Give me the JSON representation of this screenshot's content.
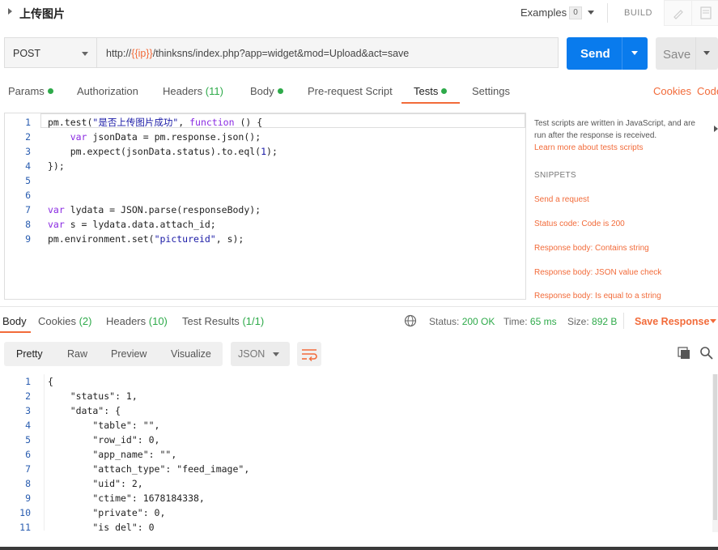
{
  "request": {
    "title": "上传图片",
    "examples_label": "Examples",
    "examples_count": "0",
    "build_label": "BUILD",
    "method": "POST",
    "url_prefix": "http://",
    "url_variable": "{{ip}}",
    "url_suffix": "/thinksns/index.php?app=widget&mod=Upload&act=save",
    "send_label": "Send",
    "save_label": "Save"
  },
  "request_tabs": {
    "params": "Params",
    "authorization": "Authorization",
    "headers": "Headers",
    "headers_count": "(11)",
    "body": "Body",
    "prerequest": "Pre-request Script",
    "tests": "Tests",
    "settings": "Settings",
    "cookies": "Cookies",
    "code": "Code"
  },
  "editor": {
    "line_numbers": [
      "1",
      "2",
      "3",
      "4",
      "5",
      "6",
      "7",
      "8",
      "9"
    ]
  },
  "sidebar": {
    "description": "Test scripts are written in JavaScript, and are run after the response is received.",
    "learn_more": "Learn more about tests scripts",
    "snippets_title": "SNIPPETS",
    "snippets": [
      "Send a request",
      "Status code: Code is 200",
      "Response body: Contains string",
      "Response body: JSON value check",
      "Response body: Is equal to a string"
    ]
  },
  "response_tabs": {
    "body": "Body",
    "cookies": "Cookies",
    "cookies_count": "(2)",
    "headers": "Headers",
    "headers_count": "(10)",
    "test_results": "Test Results",
    "test_results_count": "(1/1)",
    "status_label": "Status:",
    "status_value": "200 OK",
    "time_label": "Time:",
    "time_value": "65 ms",
    "size_label": "Size:",
    "size_value": "892 B",
    "save_response": "Save Response"
  },
  "response_toolbar": {
    "pretty": "Pretty",
    "raw": "Raw",
    "preview": "Preview",
    "visualize": "Visualize",
    "format": "JSON"
  },
  "response_body": {
    "line_numbers": [
      "1",
      "2",
      "3",
      "4",
      "5",
      "6",
      "7",
      "8",
      "9",
      "10",
      "11"
    ],
    "lines": [
      "{",
      "    \"status\": 1,",
      "    \"data\": {",
      "        \"table\": \"\",",
      "        \"row_id\": 0,",
      "        \"app_name\": \"\",",
      "        \"attach_type\": \"feed_image\",",
      "        \"uid\": 2,",
      "        \"ctime\": 1678184338,",
      "        \"private\": 0,",
      "        \"is_del\": 0"
    ]
  },
  "colors": {
    "accent": "#f26b3a",
    "send": "#097bed",
    "success": "#2eaa4a"
  }
}
